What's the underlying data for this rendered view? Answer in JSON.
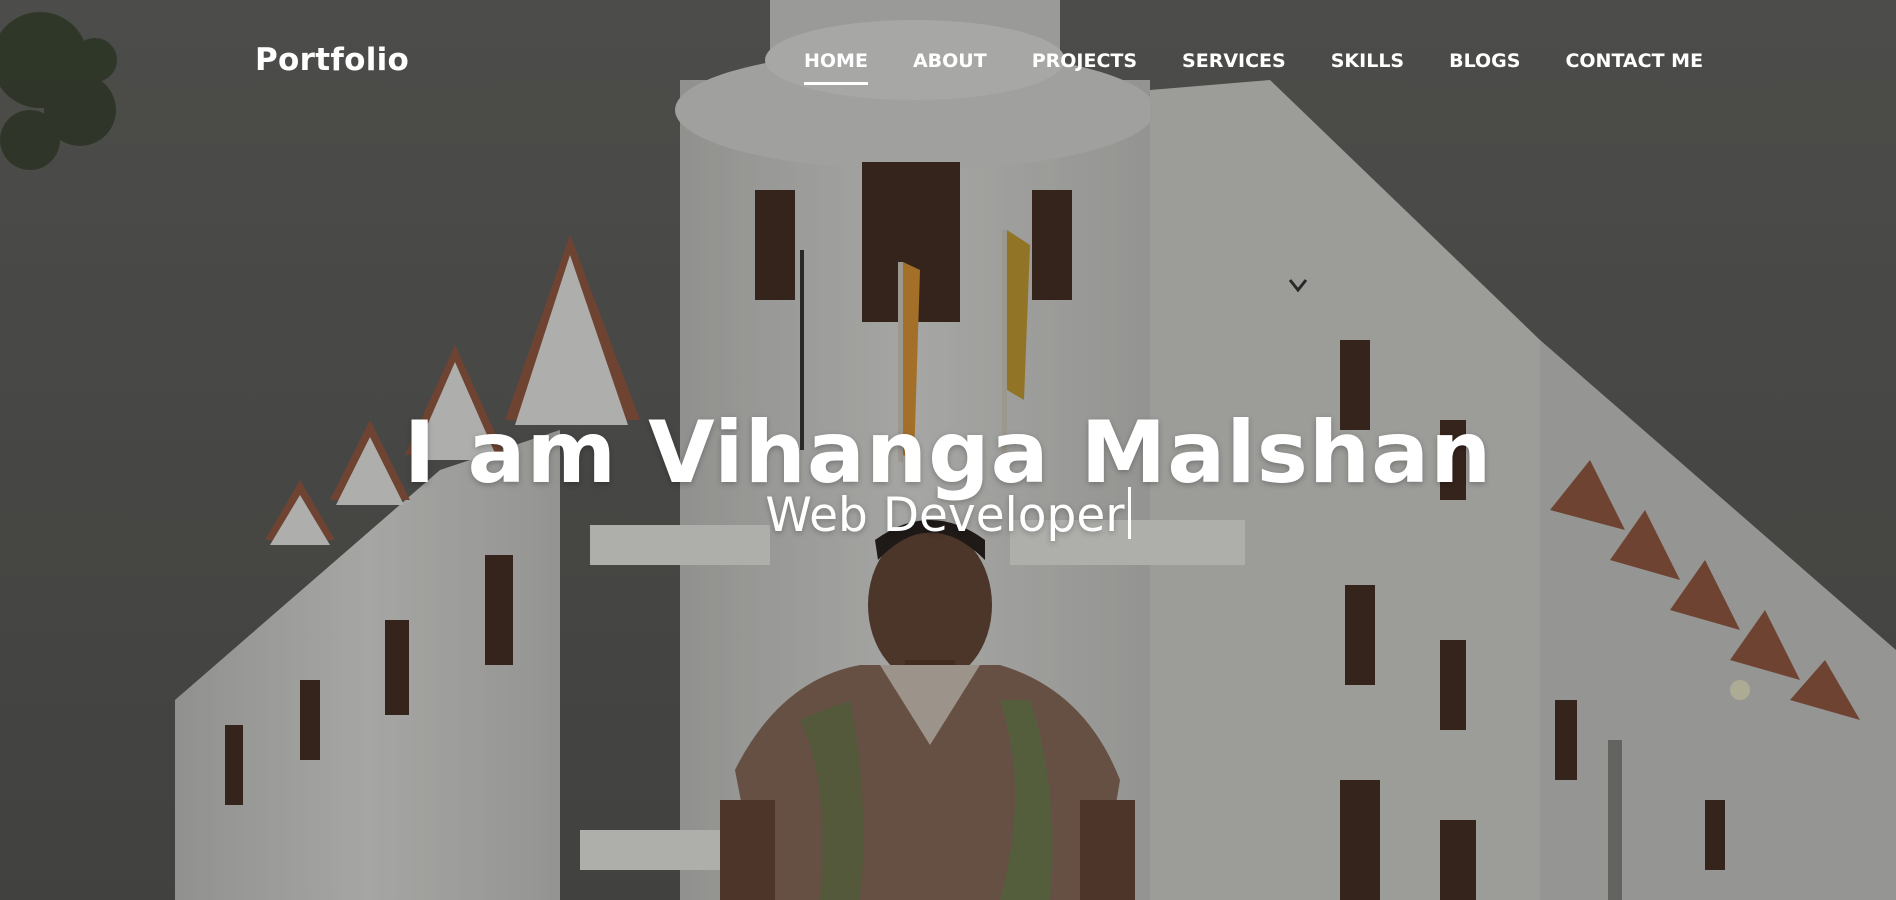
{
  "nav": {
    "brand": "Portfolio",
    "items": [
      {
        "label": "HOME",
        "active": true
      },
      {
        "label": "ABOUT"
      },
      {
        "label": "PROJECTS"
      },
      {
        "label": "SERVICES"
      },
      {
        "label": "SKILLS"
      },
      {
        "label": "BLOGS"
      },
      {
        "label": "CONTACT ME"
      }
    ]
  },
  "hero": {
    "title": "I am Vihanga Malshan",
    "subtitle": "Web Developer"
  },
  "colors": {
    "text": "#ffffff",
    "sky": "#6b6b68",
    "building": "#cfcfcc"
  }
}
